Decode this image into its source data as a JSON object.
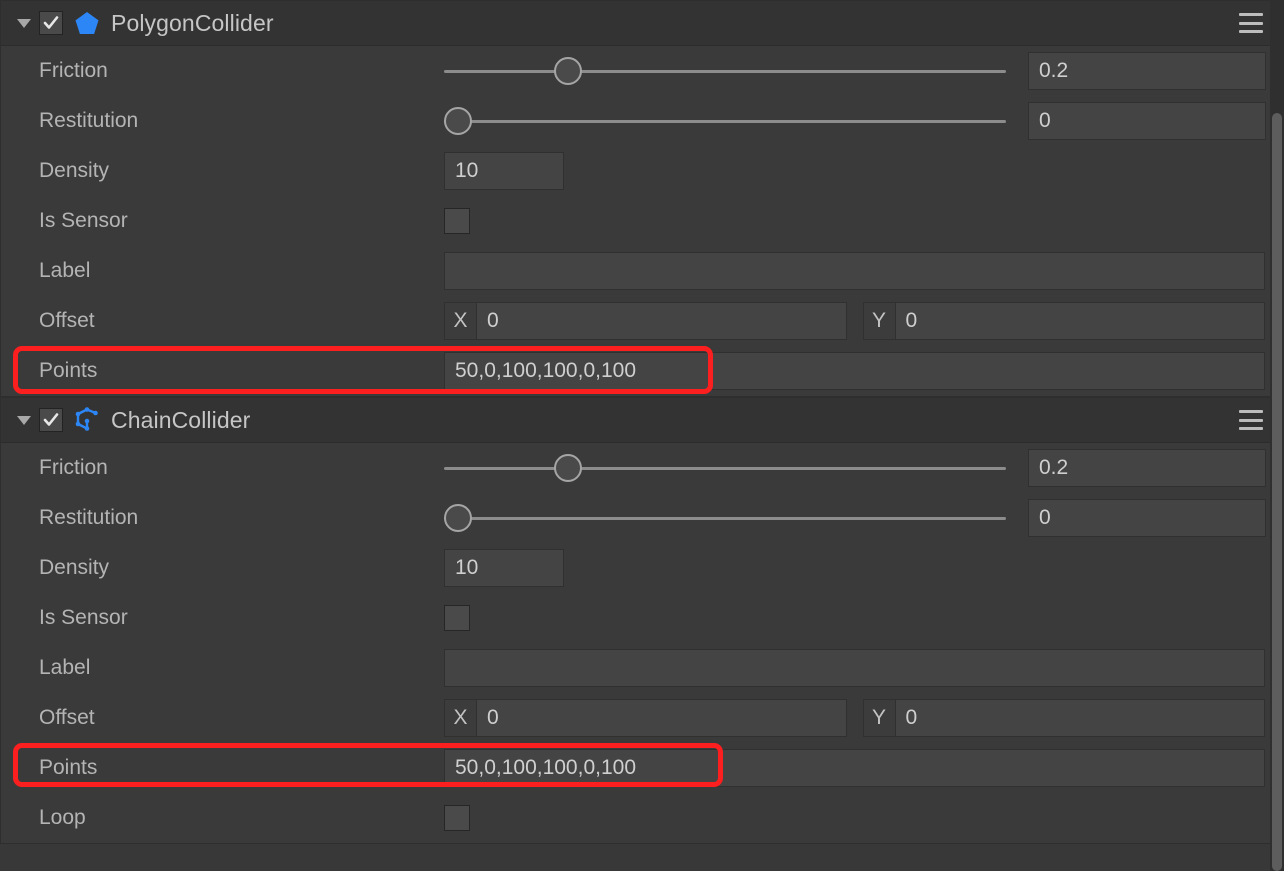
{
  "panel": {
    "scrollbar": {
      "thumb_top_pct": 13,
      "thumb_height_pct": 87
    }
  },
  "colors": {
    "accent_icon": "#2d86f5",
    "highlight": "#fc1f1f",
    "panel_bg": "#3a3a3a",
    "header_bg": "#333333",
    "field_bg": "#444444",
    "label_text": "#b4b4b4",
    "value_text": "#cfcfcf"
  },
  "components": [
    {
      "id": "polygon-collider",
      "title": "PolygonCollider",
      "icon": "pentagon-icon",
      "enabled": true,
      "expanded": true,
      "menu_icon": "hamburger-menu-icon",
      "properties": [
        {
          "type": "slider",
          "label": "Friction",
          "value": "0.2",
          "fill_pct": 22
        },
        {
          "type": "slider",
          "label": "Restitution",
          "value": "0",
          "fill_pct": 2
        },
        {
          "type": "number",
          "label": "Density",
          "value": "10"
        },
        {
          "type": "checkbox",
          "label": "Is Sensor",
          "checked": false
        },
        {
          "type": "text",
          "label": "Label",
          "value": ""
        },
        {
          "type": "vector2",
          "label": "Offset",
          "x_tag": "X",
          "x_value": "0",
          "y_tag": "Y",
          "y_value": "0"
        },
        {
          "type": "text",
          "label": "Points",
          "value": "50,0,100,100,0,100",
          "highlighted": true
        }
      ]
    },
    {
      "id": "chain-collider",
      "title": "ChainCollider",
      "icon": "chain-polyline-icon",
      "enabled": true,
      "expanded": true,
      "menu_icon": "hamburger-menu-icon",
      "properties": [
        {
          "type": "slider",
          "label": "Friction",
          "value": "0.2",
          "fill_pct": 22
        },
        {
          "type": "slider",
          "label": "Restitution",
          "value": "0",
          "fill_pct": 2
        },
        {
          "type": "number",
          "label": "Density",
          "value": "10"
        },
        {
          "type": "checkbox",
          "label": "Is Sensor",
          "checked": false
        },
        {
          "type": "text",
          "label": "Label",
          "value": ""
        },
        {
          "type": "vector2",
          "label": "Offset",
          "x_tag": "X",
          "x_value": "0",
          "y_tag": "Y",
          "y_value": "0"
        },
        {
          "type": "text",
          "label": "Points",
          "value": "50,0,100,100,0,100",
          "highlighted": true
        },
        {
          "type": "checkbox",
          "label": "Loop",
          "checked": false
        }
      ]
    }
  ]
}
